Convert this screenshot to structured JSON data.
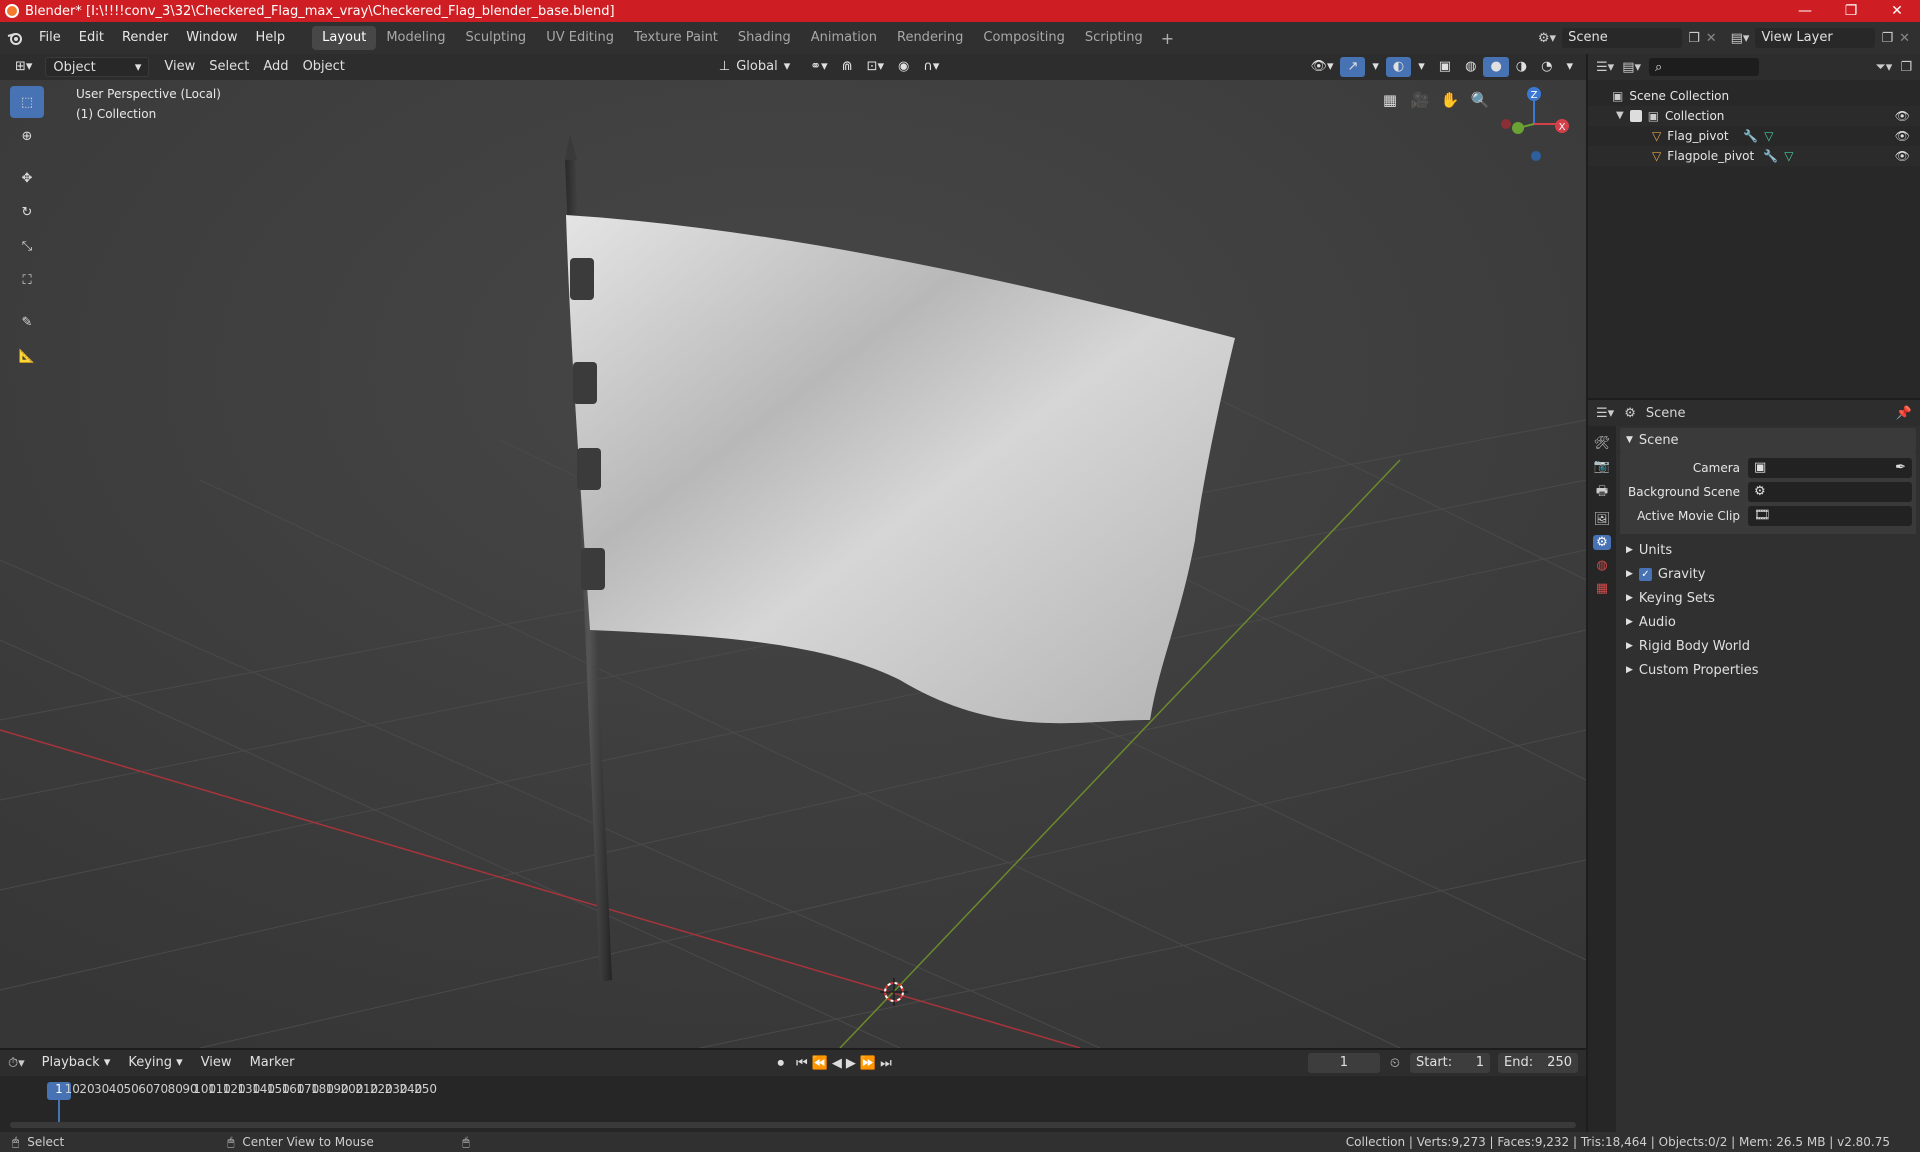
{
  "window": {
    "title": "Blender* [I:\\!!!!conv_3\\32\\Checkered_Flag_max_vray\\Checkered_Flag_blender_base.blend]",
    "minimize": "—",
    "maximize": "❐",
    "close": "✕"
  },
  "menubar": {
    "menus": [
      "File",
      "Edit",
      "Render",
      "Window",
      "Help"
    ],
    "workspaces": [
      "Layout",
      "Modeling",
      "Sculpting",
      "UV Editing",
      "Texture Paint",
      "Shading",
      "Animation",
      "Rendering",
      "Compositing",
      "Scripting"
    ],
    "active_workspace": "Layout",
    "add_workspace": "+",
    "scene": "Scene",
    "view_layer": "View Layer"
  },
  "viewport_header": {
    "mode": "Object Mode",
    "menus": [
      "View",
      "Select",
      "Add",
      "Object"
    ],
    "transform_orientation": "Global"
  },
  "viewport": {
    "perspective_label": "User Perspective (Local)",
    "collection_label": "(1) Collection",
    "gizmo_axes": {
      "x": "X",
      "y": "Y",
      "z": "Z"
    }
  },
  "outliner": {
    "root": "Scene Collection",
    "collection": "Collection",
    "objects": [
      "Flag_pivot",
      "Flagpole_pivot"
    ]
  },
  "properties": {
    "header": "Scene",
    "panel_title": "Scene",
    "fields": {
      "camera_label": "Camera",
      "background_label": "Background Scene",
      "movie_clip_label": "Active Movie Clip"
    },
    "sections": [
      "Units",
      "Gravity",
      "Keying Sets",
      "Audio",
      "Rigid Body World",
      "Custom Properties"
    ],
    "gravity_checked": true
  },
  "timeline": {
    "menus": [
      "Playback",
      "Keying",
      "View",
      "Marker"
    ],
    "current_frame": "1",
    "start_label": "Start:",
    "start": "1",
    "end_label": "End:",
    "end": "250",
    "ticks": [
      "1",
      "10",
      "20",
      "30",
      "40",
      "50",
      "60",
      "70",
      "80",
      "90",
      "100",
      "110",
      "120",
      "130",
      "140",
      "150",
      "160",
      "170",
      "180",
      "190",
      "200",
      "210",
      "220",
      "230",
      "240",
      "250"
    ]
  },
  "statusbar": {
    "select": "Select",
    "center_view": "Center View to Mouse",
    "stats": "Collection | Verts:9,273 | Faces:9,232 | Tris:18,464 | Objects:0/2 | Mem: 26.5 MB | v2.80.75"
  },
  "colors": {
    "titlebar": "#cf1e23",
    "accent": "#4772b3",
    "object_icon": "#e5a04b",
    "modifier_icon": "#5aa9e6",
    "mesh_icon": "#46c8a0"
  }
}
